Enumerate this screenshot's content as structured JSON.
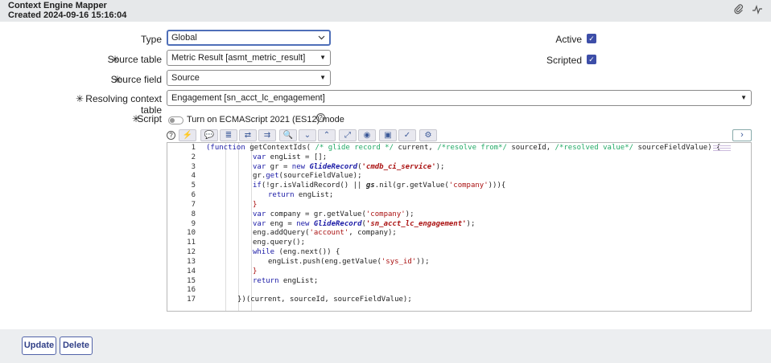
{
  "header": {
    "title": "Context Engine Mapper",
    "created": "Created 2024-09-16 15:16:04"
  },
  "form": {
    "type": {
      "label": "Type",
      "value": "Global"
    },
    "source_table": {
      "label": "Source table",
      "value": "Metric Result [asmt_metric_result]"
    },
    "source_field": {
      "label": "Source field",
      "value": "Source"
    },
    "resolving_context_table": {
      "label": "Resolving context table",
      "value": "Engagement [sn_acct_lc_engagement]"
    },
    "script": {
      "label": "Script",
      "toggle_label": "Turn on ECMAScript 2021 (ES12) mode"
    },
    "active": {
      "label": "Active",
      "checked": true
    },
    "scripted": {
      "label": "Scripted",
      "checked": true
    },
    "required_marker": "✳"
  },
  "editor": {
    "line_numbers": [
      "1",
      "2",
      "3",
      "4",
      "5",
      "6",
      "7",
      "8",
      "9",
      "10",
      "11",
      "12",
      "13",
      "14",
      "15",
      "16",
      "17"
    ]
  },
  "footer": {
    "update_label": "Update",
    "delete_label": "Delete"
  },
  "colors": {
    "accent": "#3d4ea8",
    "header_bg": "#e6e8ea"
  }
}
